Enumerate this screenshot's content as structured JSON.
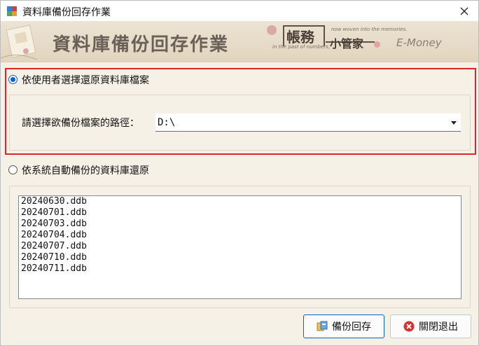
{
  "window": {
    "title": "資料庫備份回存作業"
  },
  "banner": {
    "title": "資料庫備份回存作業",
    "brand_name": "帳務",
    "brand_small": "小管家",
    "brand_tagline_1": "now woven into the memories.",
    "brand_tagline_2": "in the past of numbers,",
    "brand_emoney": "E-Money"
  },
  "option_user": {
    "label": "依使用者選擇還原資料庫檔案",
    "checked": true,
    "path_label": "請選擇欲備份檔案的路徑：",
    "path_value": "D:\\"
  },
  "option_auto": {
    "label": "依系統自動備份的資料庫還原",
    "checked": false,
    "files": [
      "20240630.ddb",
      "20240701.ddb",
      "20240703.ddb",
      "20240704.ddb",
      "20240707.ddb",
      "20240710.ddb",
      "20240711.ddb"
    ]
  },
  "buttons": {
    "restore_label": "備份回存",
    "exit_label": "關閉退出"
  },
  "colors": {
    "highlight_frame": "#e0242b",
    "accent": "#0a5fd1",
    "background": "#f5f1e6"
  }
}
